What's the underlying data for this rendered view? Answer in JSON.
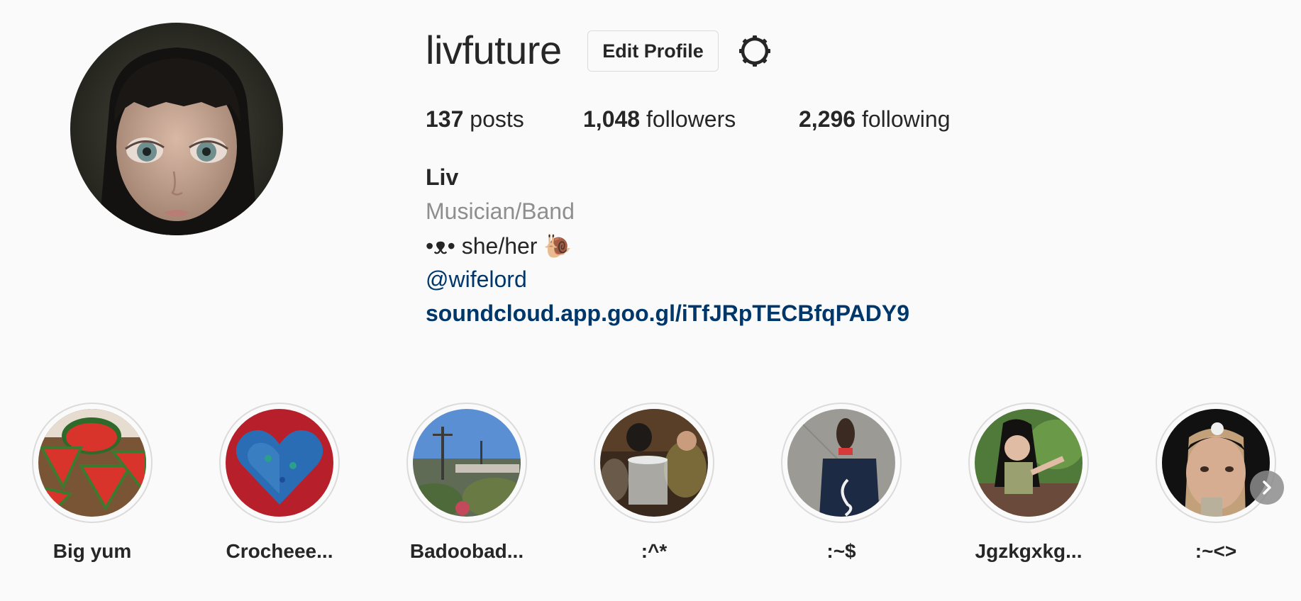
{
  "profile": {
    "username": "livfuture",
    "edit_label": "Edit Profile",
    "settings_icon": "gear-icon",
    "avatar_icon": "profile-avatar"
  },
  "stats": {
    "posts_count": "137",
    "posts_label": " posts",
    "followers_count": "1,048",
    "followers_label": " followers",
    "following_count": "2,296",
    "following_label": " following"
  },
  "bio": {
    "name": "Liv",
    "category": "Musician/Band",
    "text": "•ᴥ• she/her 🐌",
    "mention": "@wifelord",
    "link": "soundcloud.app.goo.gl/iTfJRpTECBfqPADY9"
  },
  "highlights": [
    {
      "label": "Big yum"
    },
    {
      "label": "Crocheee..."
    },
    {
      "label": "Badoobad..."
    },
    {
      "label": ":^*"
    },
    {
      "label": ":~$"
    },
    {
      "label": "Jgzkgxkg..."
    },
    {
      "label": ":~<>"
    }
  ],
  "highlights_next_icon": "chevron-right-icon"
}
